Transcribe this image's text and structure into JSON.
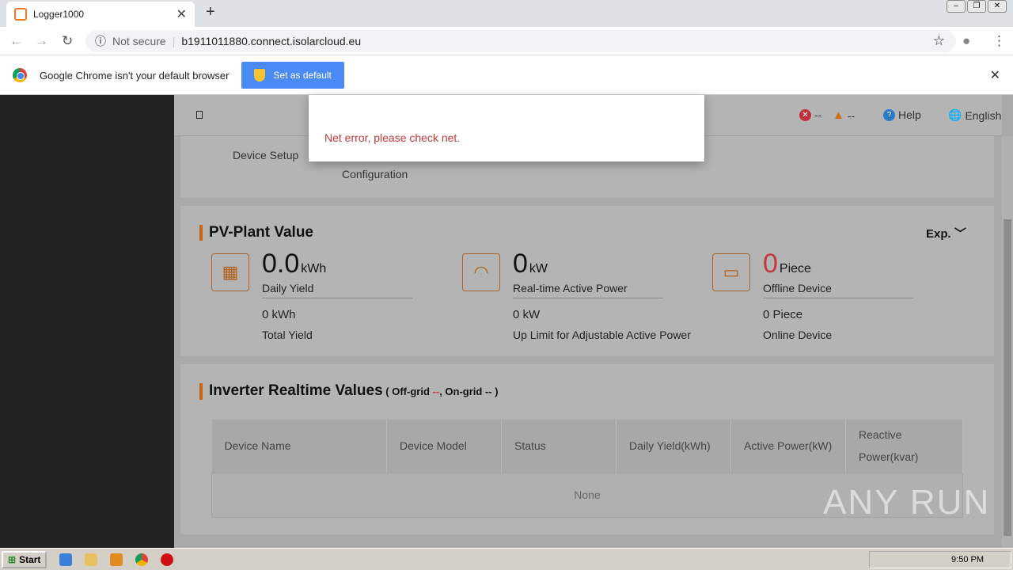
{
  "browser": {
    "tab_title": "Logger1000",
    "not_secure": "Not secure",
    "url": "b1911011880.connect.isolarcloud.eu",
    "infobar_text": "Google Chrome isn't your default browser",
    "set_default": "Set as default"
  },
  "header": {
    "error_count": "--",
    "warning_count": "--",
    "help": "Help",
    "language": "English"
  },
  "steps": {
    "device_setup": "Device Setup",
    "configuration": "Configuration"
  },
  "modal": {
    "message": "Net error, please check net."
  },
  "pv": {
    "title": "PV-Plant Value",
    "export": "Exp.",
    "stats": [
      {
        "value": "0.0",
        "unit": "kWh",
        "label": "Daily Yield",
        "value2": "0 kWh",
        "label2": "Total Yield"
      },
      {
        "value": "0",
        "unit": "kW",
        "label": "Real-time Active Power",
        "value2": "0 kW",
        "label2": "Up Limit for Adjustable Active Power"
      },
      {
        "value": "0",
        "unit": "Piece",
        "label": "Offline Device",
        "value2": "0 Piece",
        "label2": "Online Device"
      }
    ]
  },
  "inverter": {
    "title": "Inverter Realtime Values",
    "sub_open": "( Off-grid ",
    "offgrid": "--",
    "sub_mid": ", On-grid -- )",
    "columns": [
      "Device Name",
      "Device Model",
      "Status",
      "Daily Yield(kWh)",
      "Active Power(kW)",
      "Reactive Power(kvar)"
    ],
    "empty": "None"
  },
  "taskbar": {
    "start": "Start",
    "time": "9:50 PM"
  },
  "watermark": "ANY RUN",
  "colors": {
    "accent": "#c86414",
    "error": "#c0393b"
  }
}
